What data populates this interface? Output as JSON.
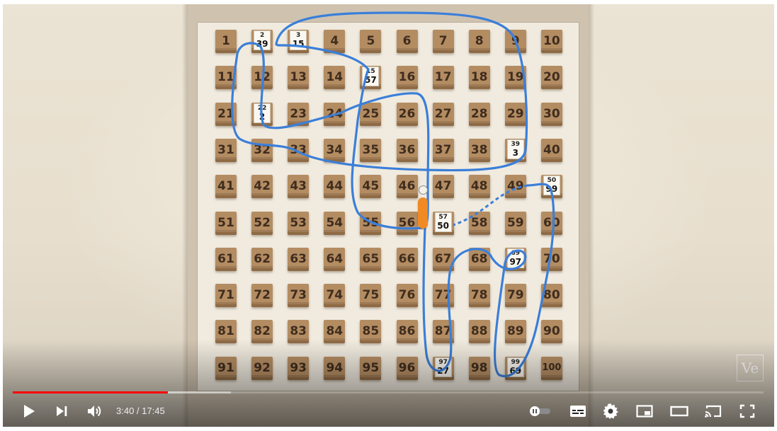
{
  "video": {
    "boxes": [
      {
        "n": "1"
      },
      {
        "n": "2",
        "card": {
          "top": "2",
          "bottom": "39"
        }
      },
      {
        "n": "3",
        "card": {
          "top": "3",
          "bottom": "15"
        }
      },
      {
        "n": "4"
      },
      {
        "n": "5"
      },
      {
        "n": "6"
      },
      {
        "n": "7"
      },
      {
        "n": "8"
      },
      {
        "n": "9"
      },
      {
        "n": "10"
      },
      {
        "n": "11"
      },
      {
        "n": "12"
      },
      {
        "n": "13"
      },
      {
        "n": "14"
      },
      {
        "n": "15",
        "card": {
          "top": "15",
          "bottom": "57"
        }
      },
      {
        "n": "16"
      },
      {
        "n": "17"
      },
      {
        "n": "18"
      },
      {
        "n": "19"
      },
      {
        "n": "20"
      },
      {
        "n": "21"
      },
      {
        "n": "22",
        "card": {
          "top": "22",
          "bottom": "2"
        }
      },
      {
        "n": "23"
      },
      {
        "n": "24"
      },
      {
        "n": "25"
      },
      {
        "n": "26"
      },
      {
        "n": "27"
      },
      {
        "n": "28"
      },
      {
        "n": "29"
      },
      {
        "n": "30"
      },
      {
        "n": "31"
      },
      {
        "n": "32"
      },
      {
        "n": "33"
      },
      {
        "n": "34"
      },
      {
        "n": "35"
      },
      {
        "n": "36"
      },
      {
        "n": "37"
      },
      {
        "n": "38"
      },
      {
        "n": "39",
        "card": {
          "top": "39",
          "bottom": "3"
        }
      },
      {
        "n": "40"
      },
      {
        "n": "41"
      },
      {
        "n": "42"
      },
      {
        "n": "43"
      },
      {
        "n": "44"
      },
      {
        "n": "45"
      },
      {
        "n": "46"
      },
      {
        "n": "47"
      },
      {
        "n": "48"
      },
      {
        "n": "49"
      },
      {
        "n": "50",
        "card": {
          "top": "50",
          "bottom": "99"
        }
      },
      {
        "n": "51"
      },
      {
        "n": "52"
      },
      {
        "n": "53"
      },
      {
        "n": "54"
      },
      {
        "n": "55"
      },
      {
        "n": "56"
      },
      {
        "n": "57",
        "card": {
          "top": "57",
          "bottom": "50"
        }
      },
      {
        "n": "58"
      },
      {
        "n": "59"
      },
      {
        "n": "60"
      },
      {
        "n": "61"
      },
      {
        "n": "62"
      },
      {
        "n": "63"
      },
      {
        "n": "64"
      },
      {
        "n": "65"
      },
      {
        "n": "66"
      },
      {
        "n": "67"
      },
      {
        "n": "68"
      },
      {
        "n": "69",
        "card": {
          "top": "69",
          "bottom": "97"
        }
      },
      {
        "n": "70"
      },
      {
        "n": "71"
      },
      {
        "n": "72"
      },
      {
        "n": "73"
      },
      {
        "n": "74"
      },
      {
        "n": "75"
      },
      {
        "n": "76"
      },
      {
        "n": "77"
      },
      {
        "n": "78"
      },
      {
        "n": "79"
      },
      {
        "n": "80"
      },
      {
        "n": "81"
      },
      {
        "n": "82"
      },
      {
        "n": "83"
      },
      {
        "n": "84"
      },
      {
        "n": "85"
      },
      {
        "n": "86"
      },
      {
        "n": "87"
      },
      {
        "n": "88"
      },
      {
        "n": "89"
      },
      {
        "n": "90"
      },
      {
        "n": "91"
      },
      {
        "n": "92"
      },
      {
        "n": "93"
      },
      {
        "n": "94"
      },
      {
        "n": "95"
      },
      {
        "n": "96"
      },
      {
        "n": "97",
        "card": {
          "top": "97",
          "bottom": "27"
        }
      },
      {
        "n": "98"
      },
      {
        "n": "99",
        "card": {
          "top": "99",
          "bottom": "69"
        }
      },
      {
        "n": "100"
      }
    ],
    "path_color": "#3b7fd9",
    "prisoner_color": "#f08a24",
    "watermark": "Ve"
  },
  "controls": {
    "current_time": "3:40",
    "separator": " / ",
    "duration": "17:45",
    "progress_played": 0.207,
    "progress_buffered": 0.291,
    "play_icon": "play-icon",
    "next_icon": "next-icon",
    "volume_icon": "volume-icon",
    "autoplay_icon": "autoplay-toggle-icon",
    "subtitles_icon": "subtitles-icon",
    "settings_icon": "gear-icon",
    "miniplayer_icon": "miniplayer-icon",
    "theater_icon": "theater-mode-icon",
    "cast_icon": "cast-icon",
    "fullscreen_icon": "fullscreen-icon",
    "accent": "#ff0000"
  }
}
